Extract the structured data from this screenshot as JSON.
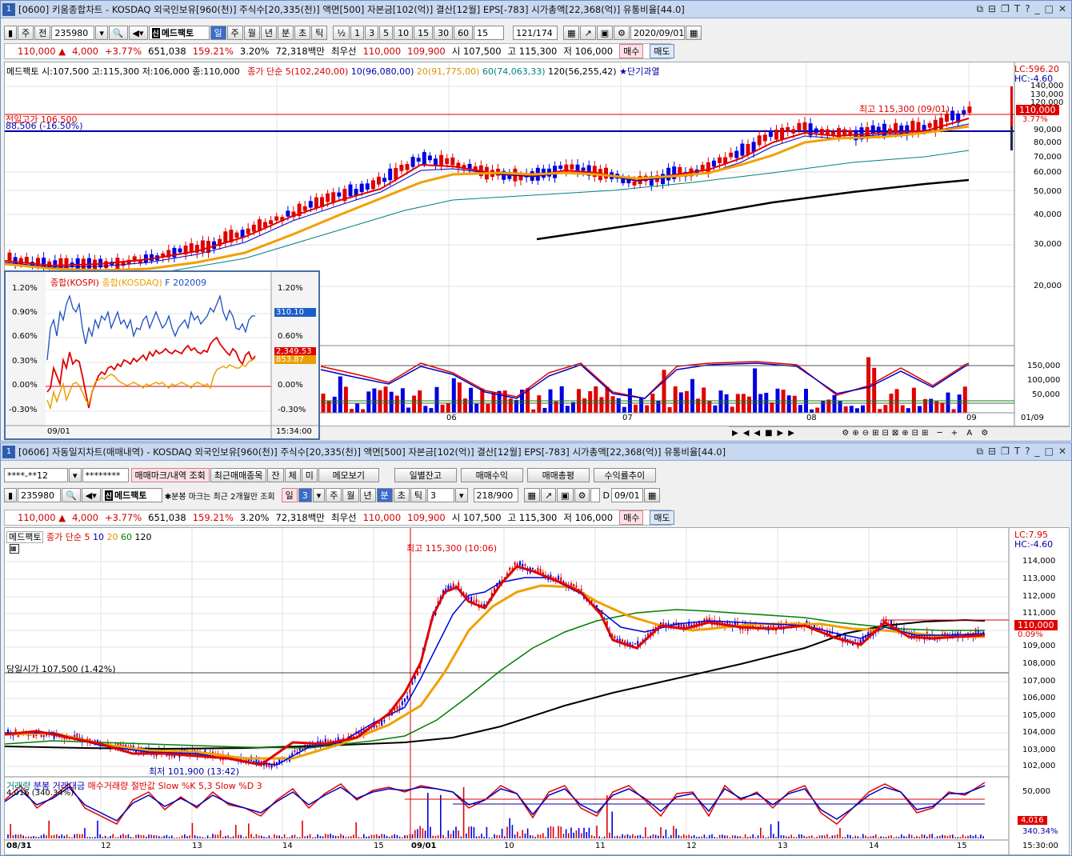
{
  "win1": {
    "num": "1",
    "title": "[0600] 키움종합차트 - KOSDAQ 외국인보유[960(천)] 주식수[20,335(천)] 액면[500] 자본금[102(억)] 결산[12월] EPS[-783] 시가총액[22,368(억)] 유통비율[44.0]",
    "toolbar": {
      "period_labels": [
        "주",
        "전"
      ],
      "code": "235980",
      "name": "메드팩토",
      "tabs": [
        "일",
        "주",
        "월",
        "년",
        "분",
        "초",
        "틱"
      ],
      "nums": [
        "½",
        "1",
        "3",
        "5",
        "10",
        "15",
        "30",
        "60"
      ],
      "sel15": "15",
      "count": "121/174",
      "date": "2020/09/01"
    },
    "quote": {
      "price": "110,000 ▲",
      "change": "4,000",
      "pct": "+3.77%",
      "vol": "651,038",
      "ratio": "159.21%",
      "turn": "3.20%",
      "amount": "72,318백만",
      "best": "최우선",
      "ask": "110,000",
      "bid": "109,900",
      "open": "시 107,500",
      "high": "고 115,300",
      "low": "저 106,000",
      "buy": "매수",
      "sell": "매도"
    },
    "legend": {
      "name": "메드팩토",
      "ohlc": "시:107,500 고:115,300 저:106,000 종:110,000",
      "ma_title": "종가 단순",
      "ma5": "5(102,240,00)",
      "ma10": "10(96,080,00)",
      "ma20": "20(91,775,00)",
      "ma60": "60(74,063,33)",
      "ma120": "120(56,255,42)",
      "star": "★단기과열"
    },
    "annot": {
      "prev_high": "전일고가 106,500",
      "level": "88,506 (-16.50%)",
      "max": "최고 115,300 (09/01)"
    },
    "right": {
      "lc": "LC:596.20",
      "hc": "HC:-4.60",
      "cur": "110,000",
      "pct": "3.77%",
      "ticks": [
        "140,000",
        "130,000",
        "120,000",
        "90,000",
        "80,000",
        "70,000",
        "60,000",
        "50,000",
        "40,000",
        "30,000",
        "20,000"
      ],
      "osc_ticks": [
        "150,000",
        "100,000",
        "50,000"
      ],
      "date": "01/09"
    },
    "xlabels": [
      "06",
      "07",
      "08",
      "09"
    ],
    "inset": {
      "l1": "종합(KOSPI)",
      "l2": "종합(KOSDAQ)",
      "l3": "F 202009",
      "left_ticks": [
        "1.20%",
        "0.90%",
        "0.60%",
        "0.30%",
        "0.00%",
        "-0.30%"
      ],
      "right_ticks": [
        "1.20%",
        "310.10",
        "0.60%",
        "2,349.53",
        "853.87",
        "0.00%",
        "-0.30%"
      ],
      "date": "09/01",
      "time": "15:34:00"
    }
  },
  "win2": {
    "num": "1",
    "title": "[0606] 자동일지차트(매매내역) - KOSDAQ 외국인보유[960(천)] 주식수[20,335(천)] 액면[500] 자본금[102(억)] 결산[12월] EPS[-783] 시가총액[22,368(억)] 유통비율[44.0]",
    "row1": {
      "acct": "****-**12",
      "pw": "********",
      "b1": "매매마크/내역 조회",
      "b2": "최근매매종목",
      "b3": "잔",
      "b4": "체",
      "b5": "미",
      "b6": "메모보기",
      "b7": "일별잔고",
      "b8": "매매수익",
      "b9": "매매총평",
      "b10": "수익률추이"
    },
    "row2": {
      "code": "235980",
      "name": "메드팩토",
      "note": "✱분봉 마크는 최근 2개월만 조회",
      "tabs": [
        "일",
        "3",
        "주",
        "월",
        "년",
        "분",
        "초",
        "틱"
      ],
      "num": "3",
      "count": "218/900",
      "date": "09/01"
    },
    "quote": {
      "price": "110,000 ▲",
      "change": "4,000",
      "pct": "+3.77%",
      "vol": "651,038",
      "ratio": "159.21%",
      "turn": "3.20%",
      "amount": "72,318백만",
      "best": "최우선",
      "ask": "110,000",
      "bid": "109,900",
      "open": "시 107,500",
      "high": "고 115,300",
      "low": "저 106,000",
      "buy": "매수",
      "sell": "매도"
    },
    "legend": {
      "name": "메드팩토",
      "ma_title": "종가 단순 5",
      "m10": "10",
      "m20": "20",
      "m60": "60",
      "m120": "120"
    },
    "annot": {
      "max": "최고 115,300 (10:06)",
      "min": "최저 101,900 (13:42)",
      "open": "당일시가 107,500 (1.42%)"
    },
    "right": {
      "lc": "LC:7.95",
      "hc": "HC:-4.60",
      "cur": "110,000",
      "pct": "0.09%",
      "ticks": [
        "114,000",
        "113,000",
        "112,000",
        "111,000",
        "109,000",
        "108,000",
        "107,000",
        "106,000",
        "105,000",
        "104,000",
        "103,000",
        "102,000"
      ],
      "osc_tick": "50,000",
      "v1": "4,016",
      "v2": "340.34%",
      "time": "15:30:00"
    },
    "osc_legend": {
      "l1": "거래량",
      "l2": "분봉 거래대금",
      "l3": "매수거래량 절반값",
      "l4": "Slow %K 5,3  Slow %D 3",
      "l5": "4,016 (340.34%)"
    },
    "xlabels": [
      "08/31",
      "12",
      "13",
      "14",
      "15",
      "09/01",
      "10",
      "11",
      "12",
      "13",
      "14",
      "15"
    ]
  },
  "colors": {
    "up": "#e00000",
    "down": "#0000e0",
    "ma20": "#f0a000",
    "ma60": "#008080",
    "ma120": "#000000"
  }
}
